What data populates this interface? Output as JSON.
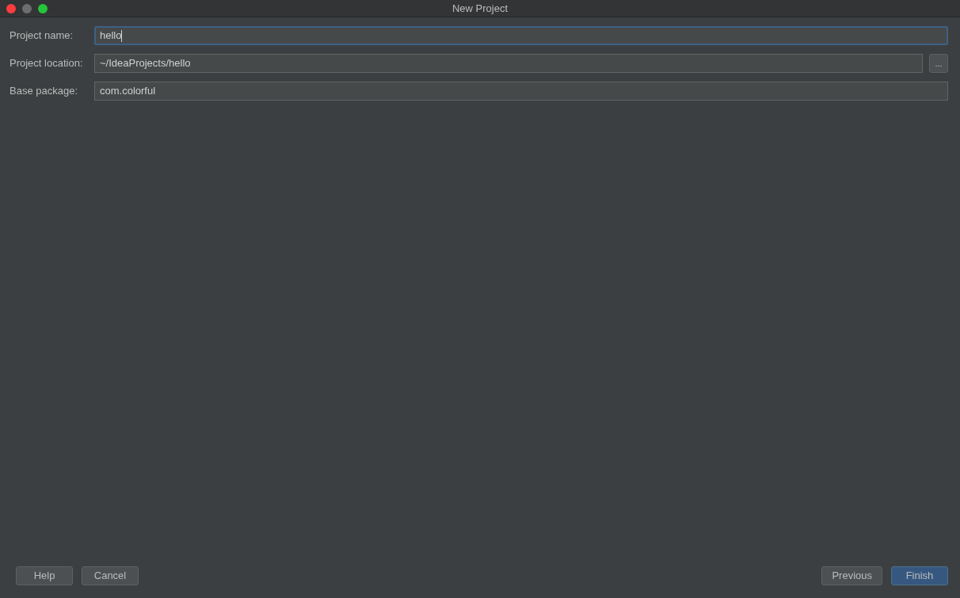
{
  "window": {
    "title": "New Project"
  },
  "fields": [
    {
      "label": "Project name:",
      "value": "hello",
      "focused": true
    },
    {
      "label": "Project location:",
      "value": "~/IdeaProjects/hello",
      "focused": false,
      "browse_button": "..."
    },
    {
      "label": "Base package:",
      "value": "com.colorful",
      "focused": false
    }
  ],
  "buttons_left": [
    {
      "label": "Help",
      "default": false
    },
    {
      "label": "Cancel",
      "default": false
    }
  ],
  "buttons_right": [
    {
      "label": "Previous",
      "default": false
    },
    {
      "label": "Finish",
      "default": true
    }
  ]
}
